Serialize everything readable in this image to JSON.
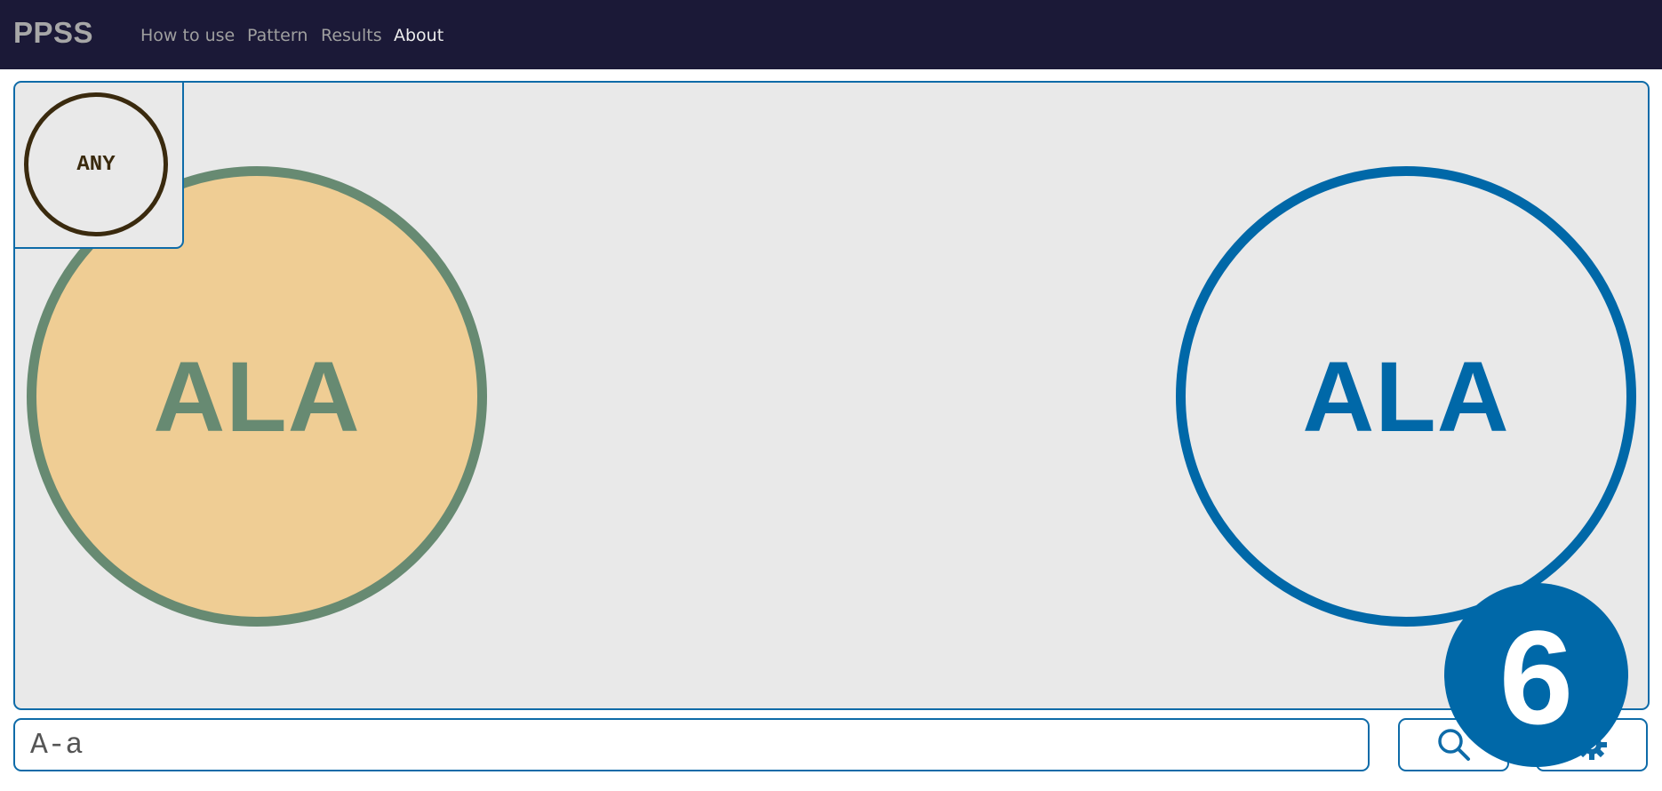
{
  "navbar": {
    "brand": "PPSS",
    "links": [
      {
        "label": "How to use"
      },
      {
        "label": "Pattern"
      },
      {
        "label": "Results"
      },
      {
        "label": "About"
      }
    ],
    "active_link": "About"
  },
  "pattern_canvas": {
    "corner_node": {
      "label": "ANY"
    },
    "nodes": [
      {
        "label": "ALA",
        "fill": "#efcd94",
        "stroke": "#678a72"
      },
      {
        "label": "ALA",
        "fill": "#e9e9e9",
        "stroke": "#0068a8"
      }
    ]
  },
  "search": {
    "value": "A-a",
    "search_icon": "search-icon",
    "settings_icon": "gear-icon"
  },
  "count_badge": {
    "value": "6"
  },
  "colors": {
    "navbar_bg": "#1b1937",
    "accent": "#0e6ba8",
    "canvas_bg": "#e9e9e9"
  }
}
